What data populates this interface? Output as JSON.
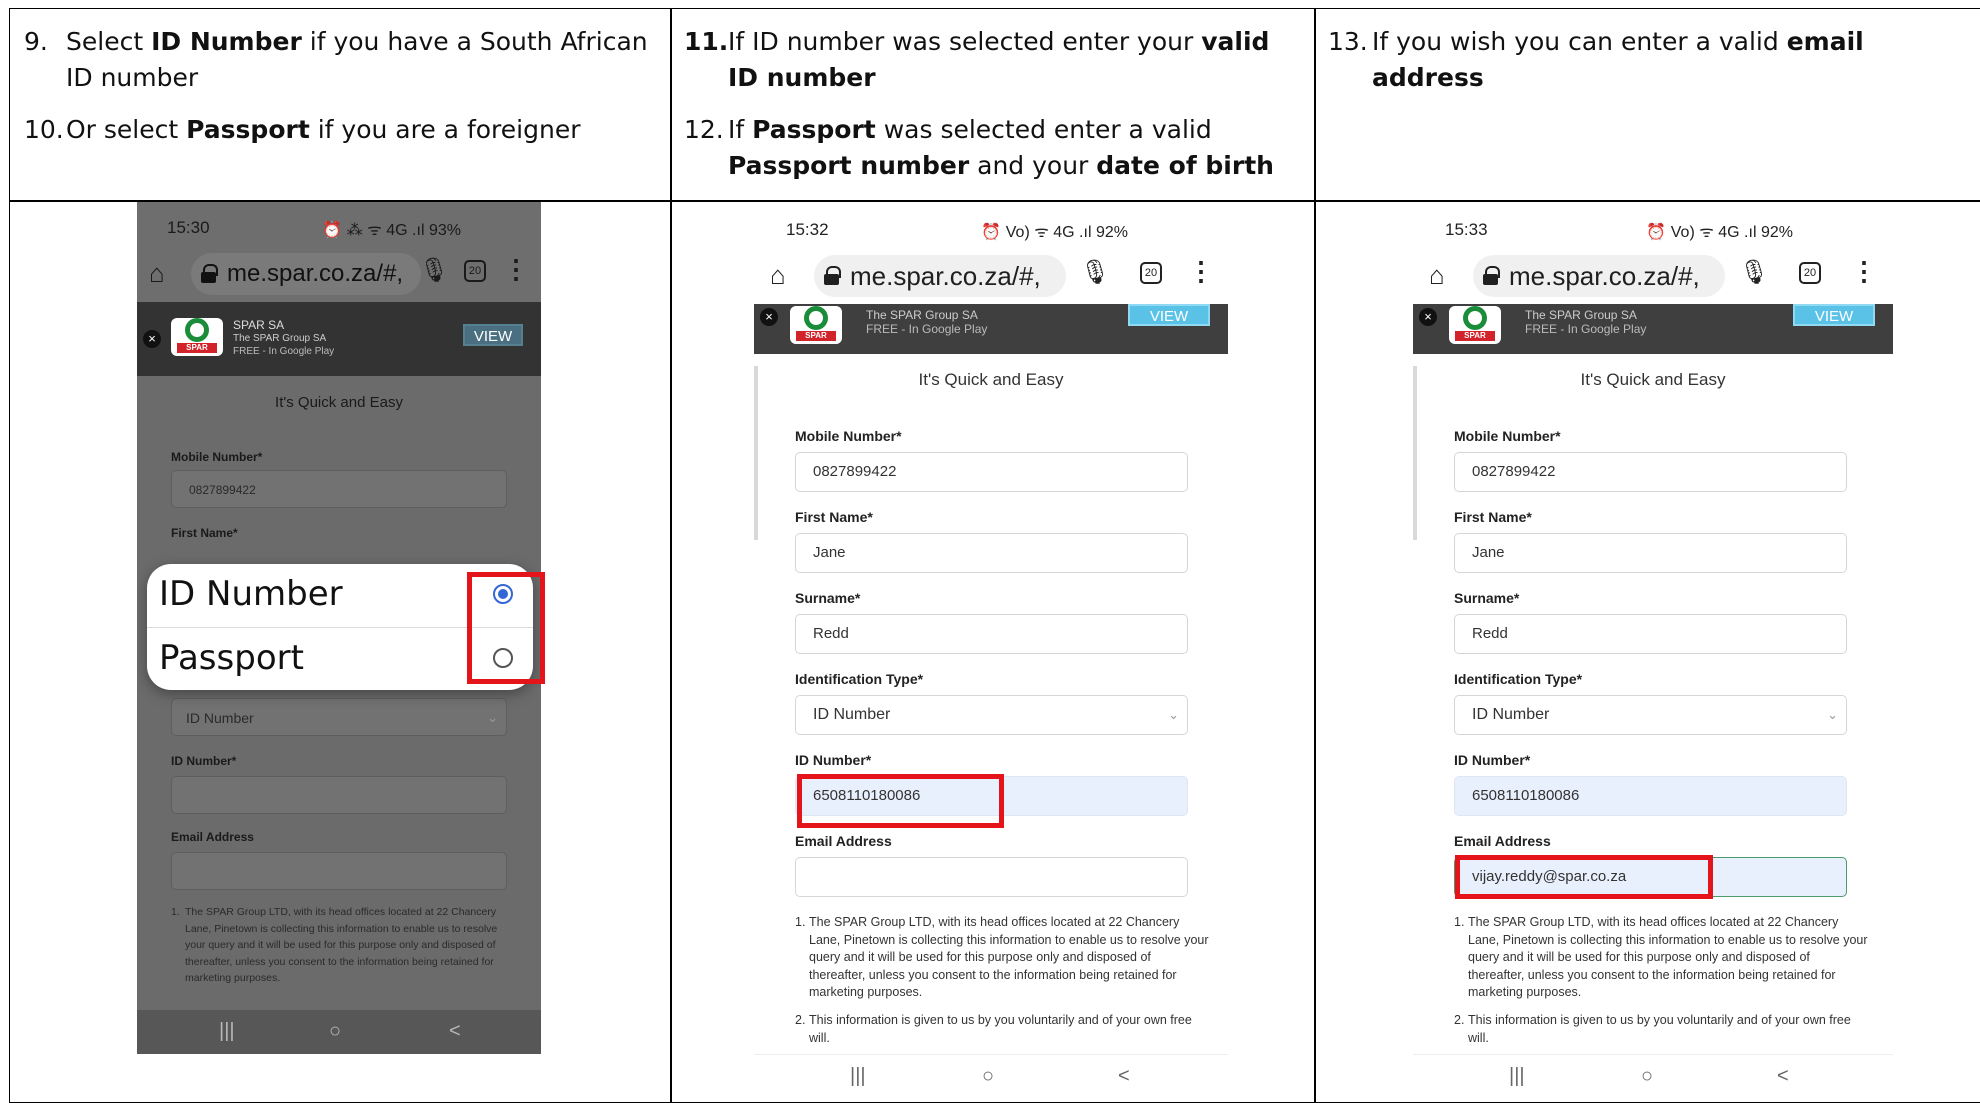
{
  "instructions": {
    "col1": [
      {
        "num": "9.",
        "parts": [
          "Select ",
          "ID Number",
          " if you have a South African ID number"
        ]
      },
      {
        "num": "10.",
        "parts": [
          "Or select ",
          "Passport",
          " if you are a foreigner"
        ]
      }
    ],
    "col2": [
      {
        "num": "11.",
        "parts": [
          "If ID number was selected enter your ",
          "valid ID number",
          ""
        ]
      },
      {
        "num": "12.",
        "parts": [
          "If ",
          "Passport",
          " was selected enter a valid ",
          "Passport number",
          " and your ",
          "date of birth",
          ""
        ]
      }
    ],
    "col3": [
      {
        "num": "13.",
        "parts": [
          "If you wish you can enter a valid ",
          "email address",
          ""
        ]
      }
    ]
  },
  "common": {
    "url": "me.spar.co.za/#,",
    "tab_count": "20",
    "banner_app": "SPAR SA",
    "banner_publisher": "The SPAR Group SA",
    "banner_store": "FREE - In Google Play",
    "banner_view": "VIEW",
    "logo_text": "SPAR",
    "form_subtitle": "It's Quick and Easy",
    "label_mobile": "Mobile Number*",
    "label_first": "First Name*",
    "label_surname": "Surname*",
    "label_idtype": "Identification Type*",
    "label_idnumber": "ID Number*",
    "label_email": "Email Address",
    "mobile_value": "0827899422",
    "first_value": "Jane",
    "surname_value": "Redd",
    "idtype_value": "ID Number",
    "idnumber_value": "6508110180086",
    "terms_1": "The SPAR Group LTD, with its head offices located at 22 Chancery Lane, Pinetown is collecting this information to enable us to resolve your query and it will be used for this purpose only and disposed of thereafter, unless you consent to the information being retained for marketing purposes.",
    "terms_2": "This information is given to us by you voluntarily and of your own free will.",
    "terms_2_partial": "This information is given to us by you voluntarily and of your",
    "terms_num_1": "1.",
    "terms_num_2": "2."
  },
  "phone1": {
    "time": "15:30",
    "status_icons": "⏰ ⁂ ᯤ 4G .ıl",
    "battery": "93%",
    "dialog_options": [
      "ID Number",
      "Passport"
    ],
    "selected_option": "ID Number"
  },
  "phone2": {
    "time": "15:32",
    "status_icons": "⏰ Vo) ᯤ 4G .ıl",
    "battery": "92%"
  },
  "phone3": {
    "time": "15:33",
    "status_icons": "⏰ Vo) ᯤ 4G .ıl",
    "battery": "92%",
    "email_value": "vijay.reddy@spar.co.za"
  },
  "nav_icons": {
    "recents": "|||",
    "home": "○",
    "back": "<"
  },
  "colors": {
    "highlight": "#e5141b",
    "accent_blue": "#3467d6",
    "brand_green": "#1a8c3a",
    "brand_red": "#d2232a"
  }
}
